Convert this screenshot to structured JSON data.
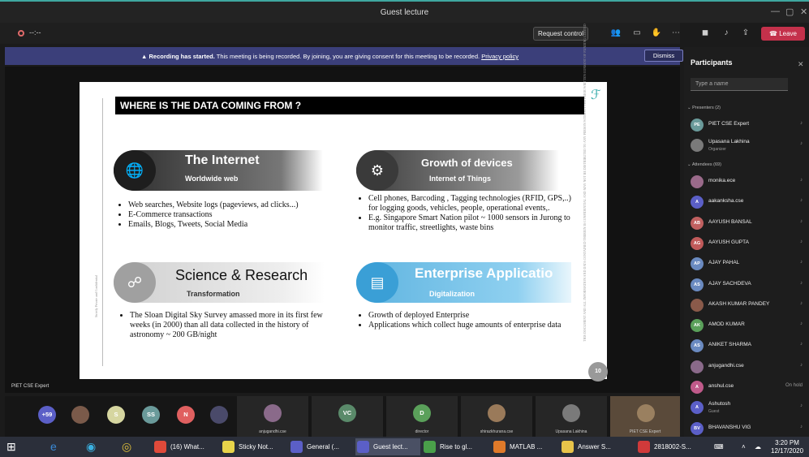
{
  "window": {
    "title": "Guest lecture"
  },
  "toolbar": {
    "timer": "--:--",
    "request_control": "Request control",
    "leave": "Leave"
  },
  "banner": {
    "bold": "Recording has started.",
    "text": " This meeting is being recorded. By joining, you are giving consent for this meeting to be recorded. ",
    "link": "Privacy policy",
    "dismiss": "Dismiss"
  },
  "slide": {
    "title": "WHERE IS THE DATA COMING FROM ?",
    "page": "10",
    "side_left": "Strictly Private and Confidential",
    "side_right": "THIS DOCUMENT AND ALL INFORMATION AND DATA CONTAINED THEREIN IS CONFIDENTIAL AND MAY NOT BE DISTRIBUTED TO ANY PERSON WITHOUT THE PRIOR WRITTEN CONSENT OF FUNDING LIMITED",
    "cats": [
      {
        "h": "The Internet",
        "s": "Worldwide web",
        "bullets": [
          "Web searches, Website logs (pageviews, ad clicks...)",
          "E-Commerce transactions",
          "Emails, Blogs, Tweets, Social Media"
        ]
      },
      {
        "h": "Growth of devices",
        "s": "Internet of Things",
        "bullets": [
          "Cell phones, Barcoding , Tagging technologies (RFID, GPS,..) for logging goods, vehicles, people, operational events,.",
          "E.g. Singapore Smart Nation pilot ~ 1000 sensors in Jurong to monitor traffic, streetlights, waste bins"
        ]
      },
      {
        "h": "Science & Research",
        "s": "Transformation",
        "bullets": [
          "The Sloan Digital Sky Survey amassed more in its first few weeks (in 2000) than all data collected in the history of astronomy ~ 200 GB/night"
        ]
      },
      {
        "h": "Enterprise Applicatio",
        "s": "Digitalization",
        "bullets": [
          "Growth of deployed Enterprise",
          "Applications which collect huge amounts of enterprise data"
        ]
      }
    ]
  },
  "speaker": "PIET CSE Expert",
  "strip": {
    "avatars": [
      {
        "t": "+59",
        "c": "#5b5fc7"
      },
      {
        "t": "",
        "c": "#7a5a4a"
      },
      {
        "t": "S",
        "c": "#d6d6a0"
      },
      {
        "t": "SS",
        "c": "#6a9a9a"
      },
      {
        "t": "N",
        "c": "#e06060"
      },
      {
        "t": "",
        "c": "#4a4a6a"
      }
    ],
    "tiles": [
      {
        "name": "anjugandhi.cse",
        "t": "",
        "c": "#8a6a8a"
      },
      {
        "name": "",
        "t": "VC",
        "c": "#5a8a6a"
      },
      {
        "name": "director",
        "t": "D",
        "c": "#5aa05a"
      },
      {
        "name": "shirazkhurana.cse",
        "t": "",
        "c": "#9a7a5a"
      },
      {
        "name": "Upasana Lakhina",
        "t": "",
        "c": "#7a7a7a"
      },
      {
        "name": "PIET CSE Expert",
        "t": "",
        "c": "#9a8060"
      }
    ]
  },
  "panel": {
    "title": "Participants",
    "placeholder": "Type a name",
    "presenters_label": "Presenters (2)",
    "attendees_label": "Attendees (69)",
    "presenters": [
      {
        "i": "PE",
        "n": "PIET CSE Expert",
        "s": "",
        "r": "",
        "c": "#6a9a9a"
      },
      {
        "i": "",
        "n": "Upasana Lakhina",
        "s": "Organizer",
        "r": "",
        "c": "#7a7a7a"
      }
    ],
    "attendees": [
      {
        "i": "",
        "n": "monika.ece",
        "s": "",
        "r": "",
        "c": "#9a6a8a"
      },
      {
        "i": "A",
        "n": "aakanksha.cse",
        "s": "",
        "r": "",
        "c": "#5b5fc7"
      },
      {
        "i": "AB",
        "n": "AAYUSH BANSAL",
        "s": "",
        "r": "",
        "c": "#c06060"
      },
      {
        "i": "AG",
        "n": "AAYUSH GUPTA",
        "s": "",
        "r": "",
        "c": "#c05a5a"
      },
      {
        "i": "AP",
        "n": "AJAY PAHAL",
        "s": "",
        "r": "",
        "c": "#6a8ac0"
      },
      {
        "i": "AS",
        "n": "AJAY SACHDEVA",
        "s": "",
        "r": "",
        "c": "#6a8ac0"
      },
      {
        "i": "",
        "n": "AKASH KUMAR PANDEY",
        "s": "",
        "r": "",
        "c": "#8a5a4a"
      },
      {
        "i": "AK",
        "n": "AMOD KUMAR",
        "s": "",
        "r": "",
        "c": "#5aa05a"
      },
      {
        "i": "AS",
        "n": "ANIKET SHARMA",
        "s": "",
        "r": "",
        "c": "#6a8ac0"
      },
      {
        "i": "",
        "n": "anjugandhi.cse",
        "s": "",
        "r": "",
        "c": "#8a6a8a"
      },
      {
        "i": "A",
        "n": "anshul.cse",
        "s": "",
        "r": "On hold",
        "c": "#c05a8a"
      },
      {
        "i": "A",
        "n": "Ashutosh",
        "s": "Guest",
        "r": "",
        "c": "#5b5fc7"
      },
      {
        "i": "BV",
        "n": "BHAVANSHU VIG",
        "s": "",
        "r": "",
        "c": "#5b5fc7"
      }
    ]
  },
  "taskbar": {
    "items": [
      {
        "l": "(16) What...",
        "c": "#e04a3a"
      },
      {
        "l": "Sticky Not...",
        "c": "#e8d44a"
      },
      {
        "l": "General (...",
        "c": "#5b5fc7"
      },
      {
        "l": "Guest lect...",
        "c": "#5b5fc7"
      },
      {
        "l": "Rise to gl...",
        "c": "#4aa04a"
      },
      {
        "l": "MATLAB ...",
        "c": "#e07a2a"
      },
      {
        "l": "Answer S...",
        "c": "#e8c44a"
      },
      {
        "l": "2818002-S...",
        "c": "#d03a3a"
      }
    ],
    "time": "3:20 PM",
    "date": "12/17/2020"
  }
}
